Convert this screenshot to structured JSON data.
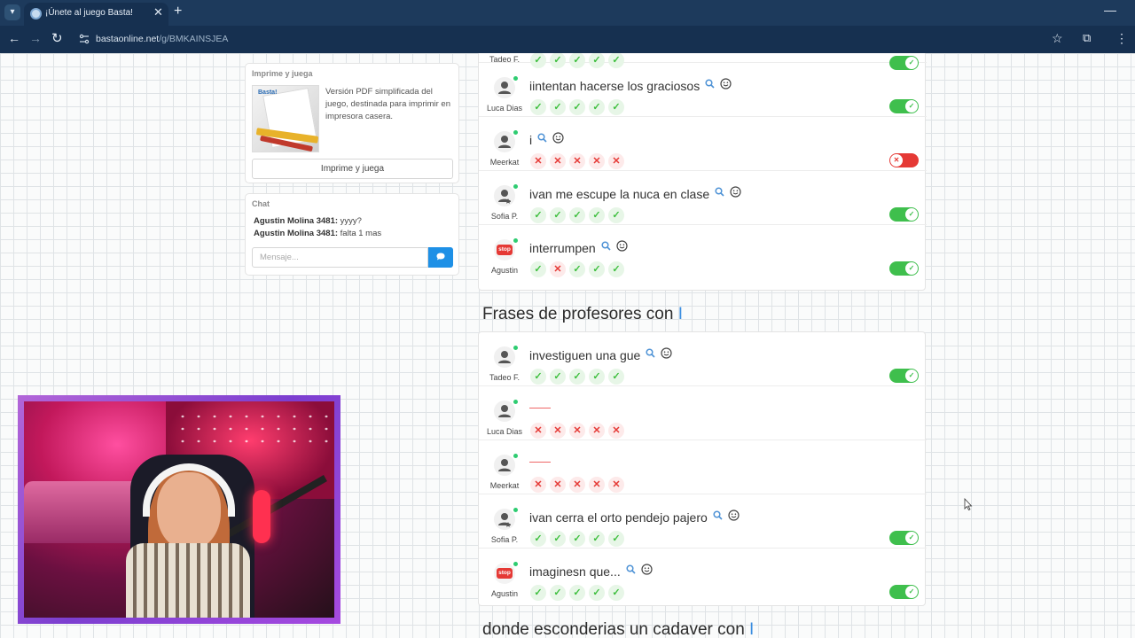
{
  "browser": {
    "tab_title": "¡Únete al juego Basta!",
    "tab_close": "✕",
    "new_tab": "+",
    "url_host": "bastaonline.net",
    "url_path": "/g/BMKAINSJEA",
    "minimize": "—"
  },
  "print_card": {
    "title": "Imprime y juega",
    "description": "Versión PDF simplificada del juego, destinada para imprimir en impresora casera.",
    "button": "Imprime y juega"
  },
  "chat": {
    "title": "Chat",
    "messages": [
      {
        "user": "Agustin Molina 3481:",
        "text": " yyyy?"
      },
      {
        "user": "Agustin Molina 3481:",
        "text": " falta 1 mas"
      }
    ],
    "placeholder": "Mensaje..."
  },
  "top_section": {
    "partial_user": "Tadeo F.",
    "rows": [
      {
        "user": "Luca Dias",
        "answer": "iintentan hacerse los graciosos",
        "votes": [
          "ok",
          "ok",
          "ok",
          "ok",
          "ok"
        ],
        "toggle": "on",
        "avatar": "person"
      },
      {
        "user": "Meerkat",
        "answer": "i",
        "votes": [
          "no",
          "no",
          "no",
          "no",
          "no"
        ],
        "toggle": "off",
        "avatar": "person"
      },
      {
        "user": "Sofia P.",
        "answer": "ivan me escupe la nuca en clase",
        "votes": [
          "ok",
          "ok",
          "ok",
          "ok",
          "ok"
        ],
        "toggle": "on",
        "avatar": "person-star"
      },
      {
        "user": "Agustin",
        "answer": "interrumpen",
        "votes": [
          "ok",
          "no",
          "ok",
          "ok",
          "ok"
        ],
        "toggle": "on",
        "avatar": "stop"
      }
    ]
  },
  "section_profesores": {
    "title": "Frases de profesores con ",
    "caret": "I",
    "rows": [
      {
        "user": "Tadeo F.",
        "answer": "investiguen una gue",
        "votes": [
          "ok",
          "ok",
          "ok",
          "ok",
          "ok"
        ],
        "toggle": "on"
      },
      {
        "user": "Luca Dias",
        "answer": "",
        "votes": [
          "no",
          "no",
          "no",
          "no",
          "no"
        ],
        "toggle": "none"
      },
      {
        "user": "Meerkat",
        "answer": "",
        "votes": [
          "no",
          "no",
          "no",
          "no",
          "no"
        ],
        "toggle": "none"
      },
      {
        "user": "Sofia P.",
        "answer": "ivan cerra el orto pendejo pajero",
        "votes": [
          "ok",
          "ok",
          "ok",
          "ok",
          "ok"
        ],
        "toggle": "on"
      },
      {
        "user": "Agustin",
        "answer": "imaginesn que...",
        "votes": [
          "ok",
          "ok",
          "ok",
          "ok",
          "ok"
        ],
        "toggle": "on"
      }
    ]
  },
  "section_cadaver": {
    "title": "donde esconderias un cadaver con ",
    "caret": "I"
  },
  "stop_label": "stop",
  "icons": {
    "check": "✓",
    "cross": "✕",
    "search": "magnifier-icon",
    "smiley": "smiley-icon"
  },
  "colors": {
    "accent": "#3b8de0",
    "ok": "#3fbf4d",
    "no": "#e53935",
    "tabbar": "#1d3a5c"
  }
}
